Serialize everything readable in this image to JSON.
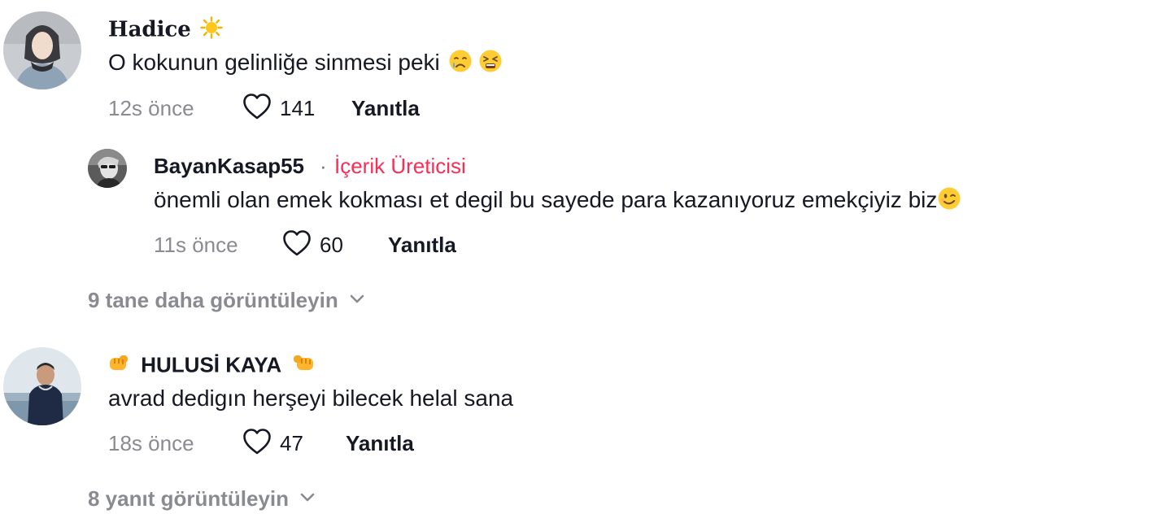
{
  "comments": [
    {
      "username": "Hadice",
      "username_emoji": "sun-emoji",
      "text": "O kokunun gelinliğe sinmesi peki",
      "text_emojis": [
        "crying-face-emoji",
        "tired-face-emoji"
      ],
      "time": "12s önce",
      "likes": "141",
      "reply_label": "Yanıtla",
      "reply": {
        "username": "BayanKasap55",
        "separator": "·",
        "creator_label": "İçerik Üreticisi",
        "text": "önemli olan emek kokması et degil bu sayede para kazanıyoruz emekçiyiz biz",
        "text_emojis": [
          "winking-face-emoji"
        ],
        "time": "11s önce",
        "likes": "60",
        "reply_label": "Yanıtla"
      },
      "view_more": "9 tane daha görüntüleyin"
    },
    {
      "username": "HULUSİ KAYA",
      "username_emojis": [
        "oncoming-fist-emoji",
        "oncoming-fist-emoji"
      ],
      "text": "avrad dedigın herşeyi bilecek helal sana",
      "time": "18s önce",
      "likes": "47",
      "reply_label": "Yanıtla",
      "view_more": "8 yanıt görüntüleyin"
    }
  ],
  "colors": {
    "text": "#161823",
    "muted": "#8a8b91",
    "creator": "#fe2c55"
  },
  "icons": {
    "like": "heart-outline-icon",
    "expand": "chevron-down-icon"
  }
}
